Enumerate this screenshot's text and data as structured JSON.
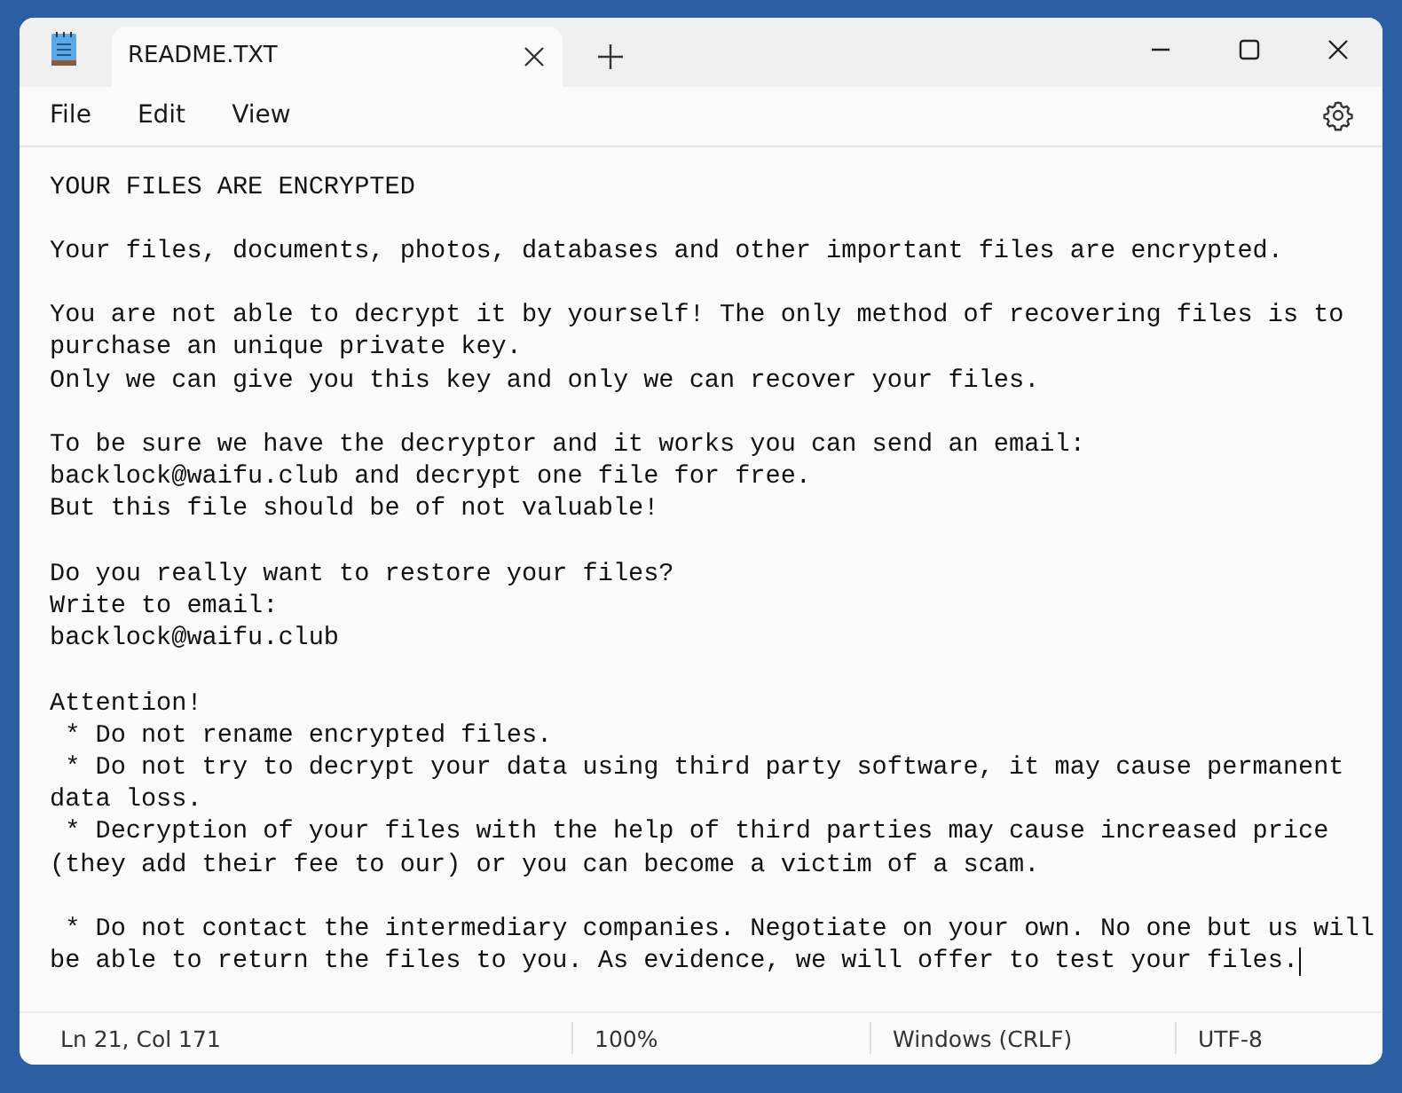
{
  "window": {
    "tab": {
      "title": "README.TXT",
      "selected": true
    }
  },
  "menu": [
    "File",
    "Edit",
    "View"
  ],
  "document": {
    "blocks": [
      [
        "YOUR FILES ARE ENCRYPTED"
      ],
      [
        "Your files, documents, photos, databases and other important files are encrypted."
      ],
      [
        "You are not able to decrypt it by yourself! The only method of recovering files is to",
        "purchase an unique private key.",
        "Only we can give you this key and only we can recover your files."
      ],
      [
        "To be sure we have the decryptor and it works you can send an email:",
        "backlock@waifu.club and decrypt one file for free.",
        "But this file should be of not valuable!"
      ],
      [
        "Do you really want to restore your files?",
        "Write to email:",
        "backlock@waifu.club"
      ],
      [
        "Attention!",
        " * Do not rename encrypted files.",
        " * Do not try to decrypt your data using third party software, it may cause permanent",
        "data loss.",
        " * Decryption of your files with the help of third parties may cause increased price",
        "(they add their fee to our) or you can become a victim of a scam."
      ],
      [
        " * Do not contact the intermediary companies. Negotiate on your own. No one but us will",
        "be able to return the files to you. As evidence, we will offer to test your files."
      ]
    ]
  },
  "status_bar": {
    "position": "Ln 21, Col 171",
    "zoom": "100%",
    "line_ending": "Windows (CRLF)",
    "encoding": "UTF-8"
  }
}
